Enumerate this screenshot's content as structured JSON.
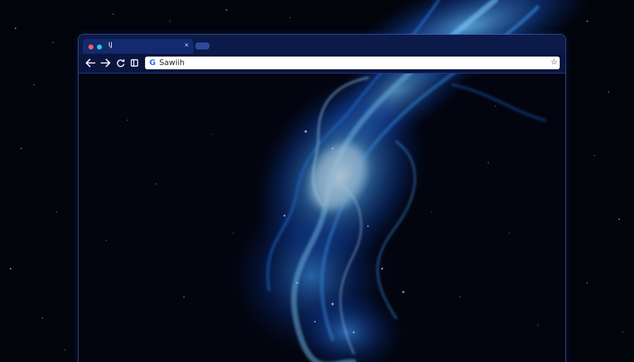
{
  "tab": {
    "title": "ƖJ",
    "close_glyph": "×",
    "dots": [
      "#ff5f57",
      "#2ec7e8",
      "#0c1a4a"
    ]
  },
  "toolbar": {
    "back_icon": "back-arrow-icon",
    "forward_icon": "forward-arrow-icon",
    "reload_icon": "reload-icon",
    "tabs_icon": "tab-overview-icon"
  },
  "address_bar": {
    "search_engine_glyph": "G",
    "text": "Sawiih",
    "bookmark_glyph": "☆"
  },
  "colors": {
    "accent": "#1a73e8",
    "nebula_core": "#9ad8ff",
    "nebula_mid": "#1e6cf0",
    "frame": "#0c1a4a"
  }
}
